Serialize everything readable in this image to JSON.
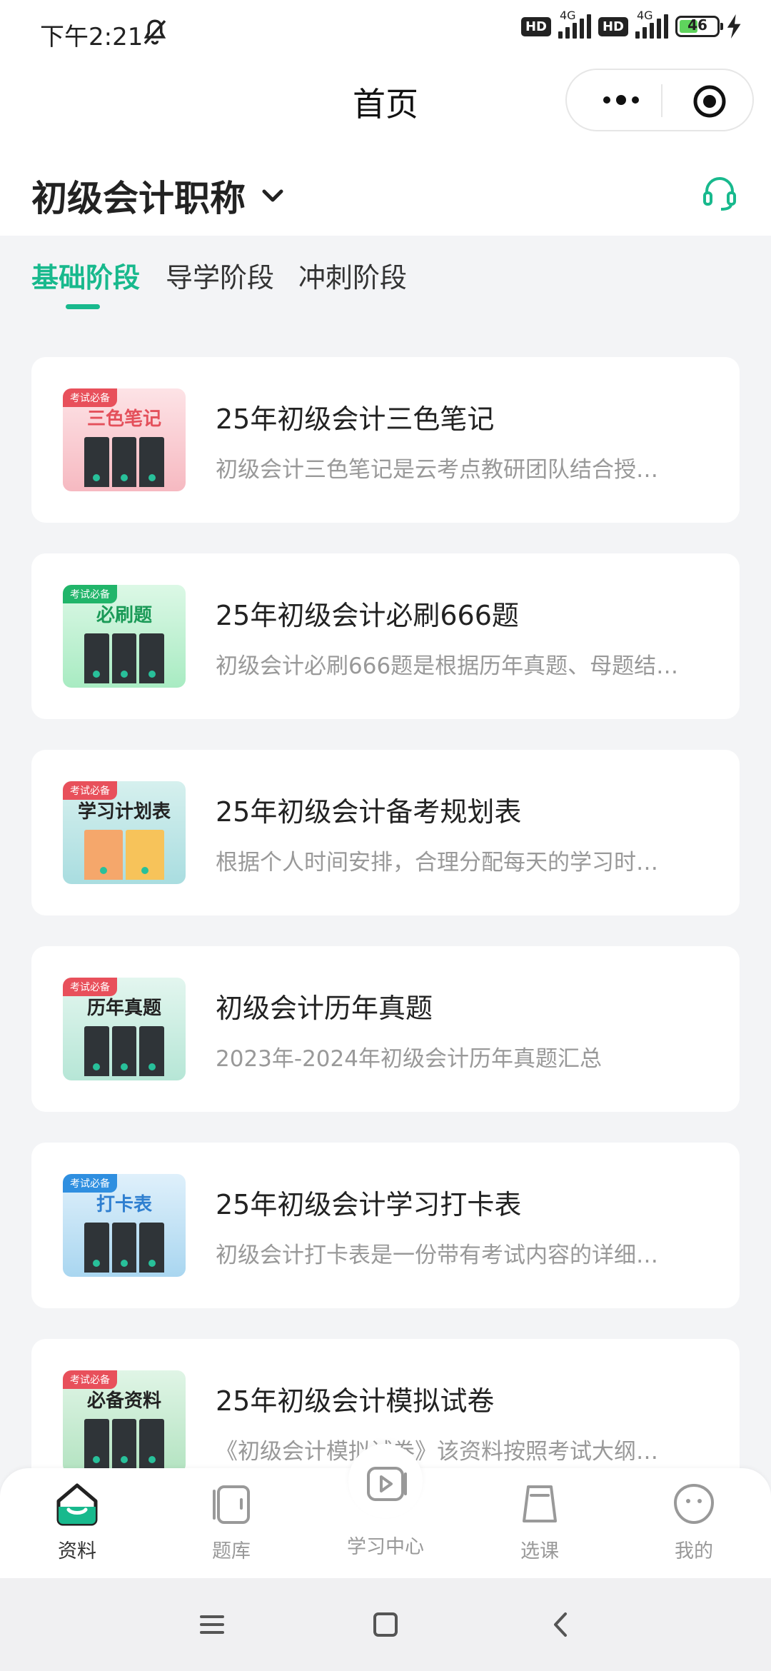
{
  "status_bar": {
    "time": "下午2:21",
    "hd1": "HD",
    "net1": "4G",
    "hd2": "HD",
    "net2": "4G",
    "battery": "46"
  },
  "navbar": {
    "title": "首页"
  },
  "exam": {
    "name": "初级会计职称"
  },
  "tabs": [
    {
      "label": "基础阶段",
      "active": true
    },
    {
      "label": "导学阶段",
      "active": false
    },
    {
      "label": "冲刺阶段",
      "active": false
    }
  ],
  "cards": [
    {
      "title": "25年初级会计三色笔记",
      "desc": "初级会计三色笔记是云考点教研团队结合授…",
      "thumb": {
        "tag": "考试必备",
        "title": "三色笔记",
        "theme": "pink"
      }
    },
    {
      "title": "25年初级会计必刷666题",
      "desc": "初级会计必刷666题是根据历年真题、母题结…",
      "thumb": {
        "tag": "考试必备",
        "title": "必刷题",
        "theme": "green"
      }
    },
    {
      "title": "25年初级会计备考规划表",
      "desc": "根据个人时间安排，合理分配每天的学习时…",
      "thumb": {
        "tag": "考试必备",
        "title": "学习计划表",
        "theme": "cyan"
      }
    },
    {
      "title": "初级会计历年真题",
      "desc": "2023年-2024年初级会计历年真题汇总",
      "thumb": {
        "tag": "考试必备",
        "title": "历年真题",
        "theme": "teal"
      }
    },
    {
      "title": "25年初级会计学习打卡表",
      "desc": "初级会计打卡表是一份带有考试内容的详细…",
      "thumb": {
        "tag": "考试必备",
        "title": "打卡表",
        "theme": "blue"
      }
    },
    {
      "title": "25年初级会计模拟试卷",
      "desc": "《初级会计模拟试卷》该资料按照考试大纲…",
      "thumb": {
        "tag": "考试必备",
        "title": "必备资料",
        "theme": "green2"
      }
    }
  ],
  "tabbar": [
    {
      "label": "资料",
      "icon": "home-smile-icon",
      "active": true
    },
    {
      "label": "题库",
      "icon": "card-stack-icon",
      "active": false
    },
    {
      "label": "学习中心",
      "icon": "play-video-icon",
      "active": false
    },
    {
      "label": "选课",
      "icon": "bag-icon",
      "active": false
    },
    {
      "label": "我的",
      "icon": "face-icon",
      "active": false
    }
  ],
  "colors": {
    "accent": "#18b98d",
    "muted": "#999999",
    "background": "#f3f4f6"
  }
}
